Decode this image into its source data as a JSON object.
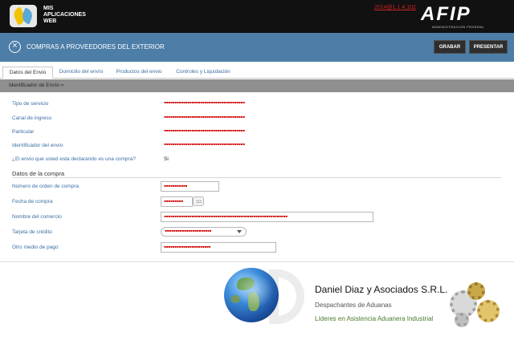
{
  "header": {
    "app_name_line1": "MIS",
    "app_name_line2": "APLICACIONES",
    "app_name_line3": "WEB",
    "version": "2014@1.1.4.102",
    "brand_logo": "AFIP",
    "brand_subtitle": "ADMINISTRACION FEDERAL"
  },
  "titlebar": {
    "close_glyph": "×",
    "title": "COMPRAS A PROVEEDORES DEL EXTERIOR",
    "grabar_label": "GRABAR",
    "presentar_label": "PRESENTAR"
  },
  "tabs": [
    {
      "label": "Datos del Envio",
      "active": true
    },
    {
      "label": "Domicilio del envío",
      "active": false
    },
    {
      "label": "Productos del envio",
      "active": false
    },
    {
      "label": "Controles y Liquidación",
      "active": false
    }
  ],
  "section": {
    "header": "Identificador de Envío =",
    "rows": [
      {
        "label": "Tipo de servicio",
        "value": "••••••••••••••••••••••••••••••••••••••"
      },
      {
        "label": "Canal de ingreso",
        "value": "••••••••••••••••••••••••••••••••••••••"
      },
      {
        "label": "Particular",
        "value": "••••••••••••••••••••••••••••••••••••••"
      },
      {
        "label": "Identificador del envio",
        "value": "••••••••••••••••••••••••••••••••••••••"
      },
      {
        "label": "¿El envio que usted esta declarando es una compra?",
        "value": "Si"
      }
    ]
  },
  "compra": {
    "title": "Datos de la compra",
    "orden_label": "Número de orden de compra",
    "orden_value": "•••••••••••",
    "fecha_label": "Fecha de compra",
    "fecha_value": "•••••••••",
    "comercio_label": "Nombre del comercio",
    "comercio_value": "••••••••••••••••••••••••••••••••••••••••••••••••••••••••••",
    "tarjeta_label": "Tarjeta de crédito",
    "tarjeta_value": "••••••••••••••••••••••",
    "otro_label": "Otro medio de pago",
    "otro_value": "••••••••••••••••••••••"
  },
  "footer": {
    "company": "Daniel Diaz y Asociados S.R.L.",
    "line1": "Despachantes de Aduanas",
    "line2": "Líderes en Asistencia Aduanera Industrial"
  },
  "icons": {
    "app_logo": "app-logo-icon",
    "close": "close-circle-icon",
    "calendar": "calendar-icon",
    "dropdown": "chevron-down-icon",
    "globe": "globe-icon",
    "gears": "gears-icon"
  },
  "colors": {
    "topbar": "#111111",
    "titlebar": "#4c7ea8",
    "label": "#3a6ea5",
    "mask": "#d00000",
    "section_header": "#8f8f8f"
  }
}
